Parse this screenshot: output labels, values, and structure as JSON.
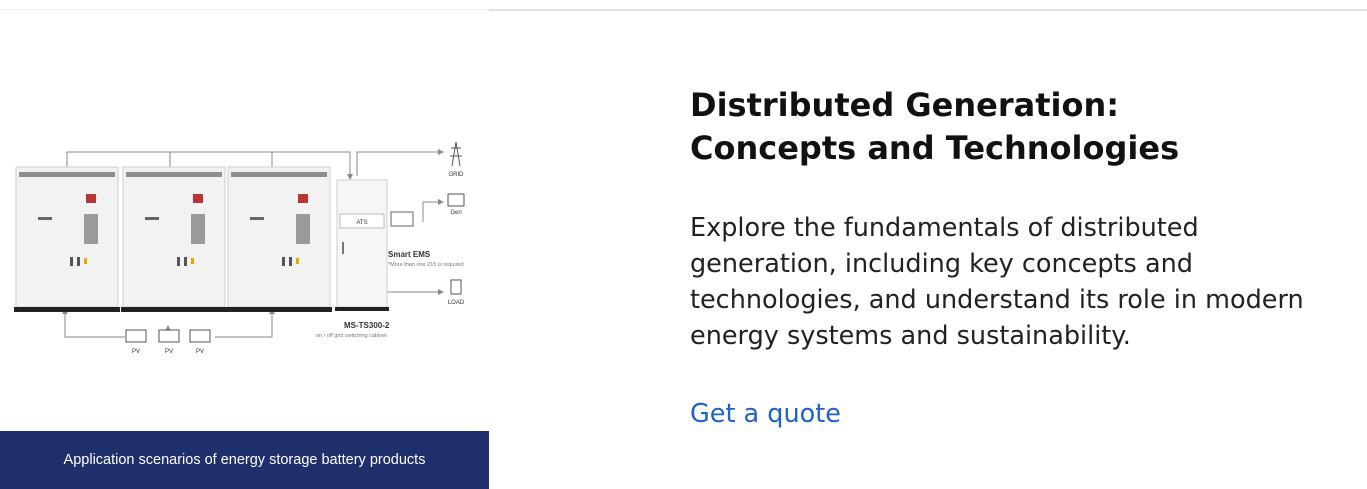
{
  "figure": {
    "caption": "Application scenarios of energy storage battery products",
    "diagram": {
      "ats": "ATS",
      "smart_ems": "Smart EMS",
      "smart_ems_note": "*More than one 215 is required",
      "model": "MS-TS300-2",
      "model_sub": "on / off grid switching cabinet",
      "grid": "GRID",
      "gen": "Gen",
      "load": "LOAD",
      "pv": "PV"
    }
  },
  "article": {
    "title_line1": "Distributed Generation:",
    "title_line2": "Concepts and Technologies",
    "description": "Explore the fundamentals of distributed generation, including key concepts and technologies, and understand its role in modern energy systems and sustainability.",
    "cta_label": "Get a quote"
  },
  "colors": {
    "caption_bg": "#1e2f6b",
    "link": "#2060c8"
  }
}
